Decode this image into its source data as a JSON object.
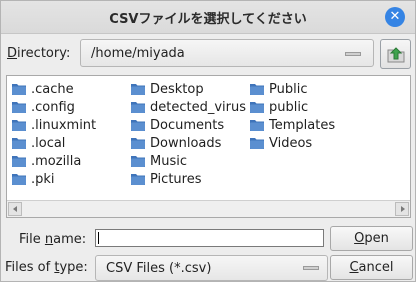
{
  "window": {
    "title": "CSVファイルを選択してください",
    "close_icon": "close-icon"
  },
  "directory": {
    "label_pre": "",
    "label_mnemonic": "D",
    "label_post": "irectory:",
    "value": "/home/miyada"
  },
  "files": {
    "columns": [
      [
        ".cache",
        ".config",
        ".linuxmint",
        ".local",
        ".mozilla",
        ".pki"
      ],
      [
        "Desktop",
        "detected_virus",
        "Documents",
        "Downloads",
        "Music",
        "Pictures"
      ],
      [
        "Public",
        "public",
        "Templates",
        "Videos"
      ]
    ],
    "icon": "folder-icon"
  },
  "filename": {
    "label_pre": "File ",
    "label_mnemonic": "n",
    "label_post": "ame:",
    "value": ""
  },
  "filetype": {
    "label_pre": "Files of ",
    "label_mnemonic": "t",
    "label_post": "ype:",
    "value": "CSV Files (*.csv)"
  },
  "buttons": {
    "open_mnemonic": "O",
    "open_rest": "pen",
    "cancel_mnemonic": "C",
    "cancel_rest": "ancel"
  },
  "colors": {
    "folder_fill": "#5b8fd0",
    "folder_tab": "#3f74ba",
    "close_button": "#3584e4",
    "up_arrow": "#3fa34d"
  }
}
